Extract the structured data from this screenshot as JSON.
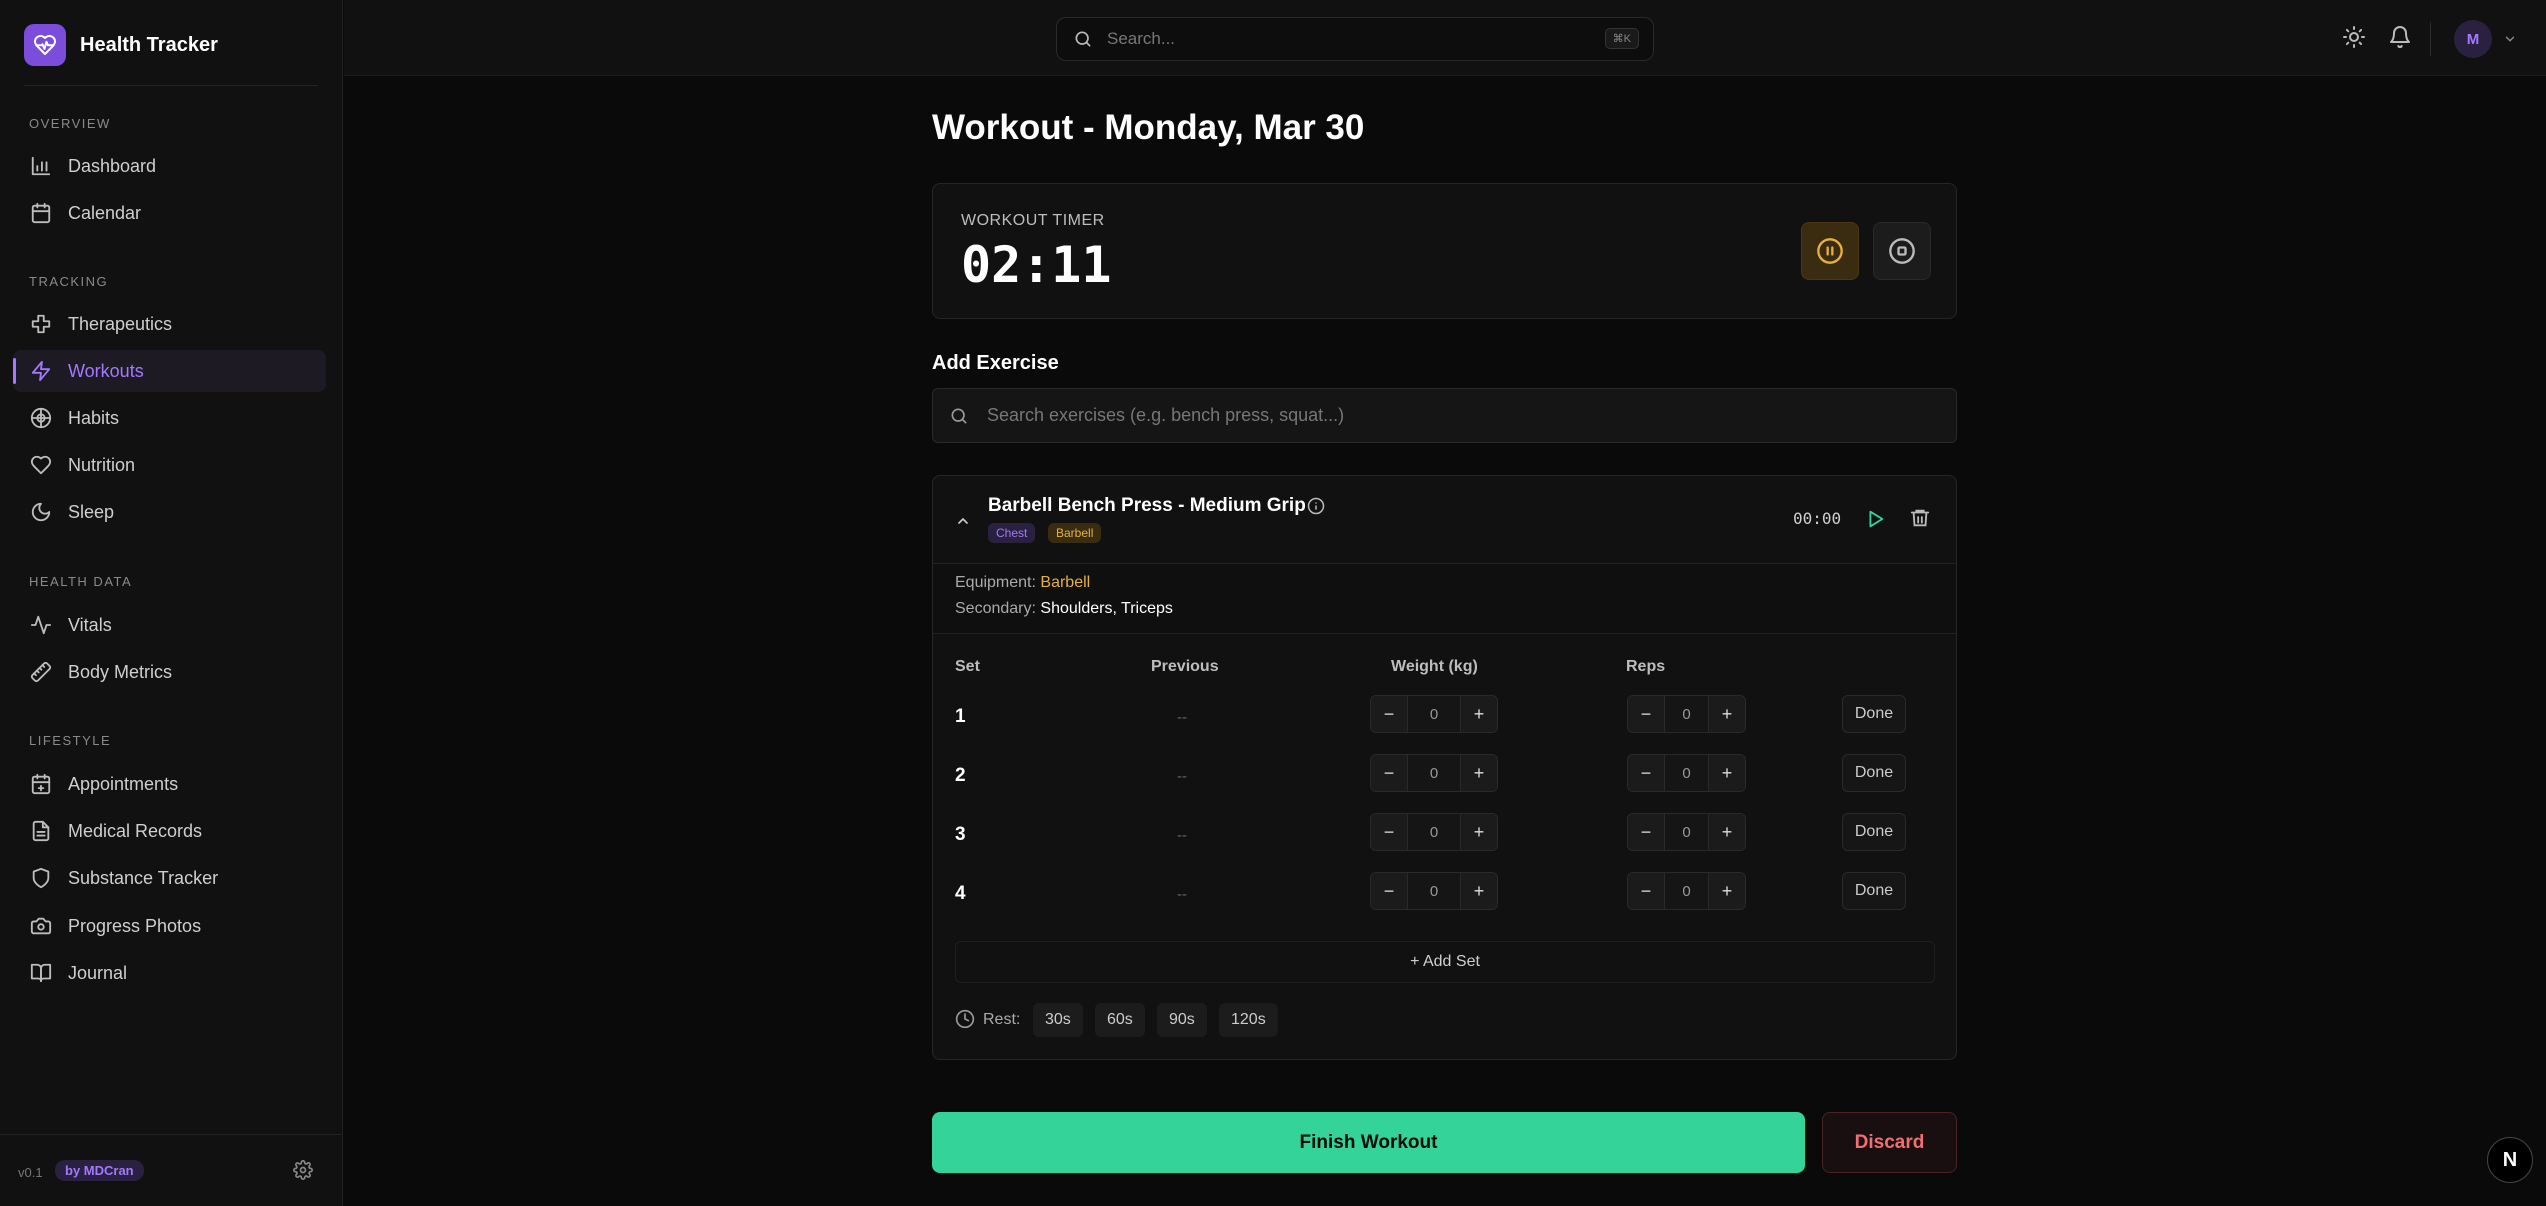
{
  "app": {
    "name": "Health Tracker",
    "version": "v0.1",
    "author_badge": "by MDCran"
  },
  "sidebar": {
    "sections": [
      {
        "label": "OVERVIEW",
        "items": [
          {
            "label": "Dashboard",
            "icon": "bar-chart-icon"
          },
          {
            "label": "Calendar",
            "icon": "calendar-icon"
          }
        ]
      },
      {
        "label": "TRACKING",
        "items": [
          {
            "label": "Therapeutics",
            "icon": "cross-icon"
          },
          {
            "label": "Workouts",
            "icon": "bolt-icon",
            "active": true
          },
          {
            "label": "Habits",
            "icon": "target-icon"
          },
          {
            "label": "Nutrition",
            "icon": "heart-icon"
          },
          {
            "label": "Sleep",
            "icon": "moon-icon"
          }
        ]
      },
      {
        "label": "HEALTH DATA",
        "items": [
          {
            "label": "Vitals",
            "icon": "pulse-icon"
          },
          {
            "label": "Body Metrics",
            "icon": "ruler-icon"
          }
        ]
      },
      {
        "label": "LIFESTYLE",
        "items": [
          {
            "label": "Appointments",
            "icon": "calendar-plus-icon"
          },
          {
            "label": "Medical Records",
            "icon": "file-icon"
          },
          {
            "label": "Substance Tracker",
            "icon": "shield-icon"
          },
          {
            "label": "Progress Photos",
            "icon": "camera-icon"
          },
          {
            "label": "Journal",
            "icon": "book-icon"
          }
        ]
      }
    ]
  },
  "topbar": {
    "search_placeholder": "Search...",
    "shortcut": "⌘K",
    "avatar_initial": "M"
  },
  "page": {
    "title": "Workout - Monday, Mar 30"
  },
  "timer": {
    "label": "WORKOUT TIMER",
    "value": "02:11"
  },
  "add_exercise": {
    "title": "Add Exercise",
    "placeholder": "Search exercises (e.g. bench press, squat...)"
  },
  "exercise": {
    "name": "Barbell Bench Press - Medium Grip",
    "tags": [
      "Chest",
      "Barbell"
    ],
    "elapsed": "00:00",
    "equipment_label": "Equipment:",
    "equipment": "Barbell",
    "secondary_label": "Secondary:",
    "secondary": "Shoulders, Triceps",
    "columns": [
      "Set",
      "Previous",
      "Weight (kg)",
      "Reps"
    ],
    "sets": [
      {
        "set": "1",
        "previous": "--",
        "weight": "0",
        "reps": "0",
        "done_label": "Done"
      },
      {
        "set": "2",
        "previous": "--",
        "weight": "0",
        "reps": "0",
        "done_label": "Done"
      },
      {
        "set": "3",
        "previous": "--",
        "weight": "0",
        "reps": "0",
        "done_label": "Done"
      },
      {
        "set": "4",
        "previous": "--",
        "weight": "0",
        "reps": "0",
        "done_label": "Done"
      }
    ],
    "add_set_label": "+ Add Set",
    "rest_label": "Rest:",
    "rest_options": [
      "30s",
      "60s",
      "90s",
      "120s"
    ]
  },
  "actions": {
    "finish_label": "Finish Workout",
    "discard_label": "Discard"
  },
  "fab_label": "N",
  "colors": {
    "accent": "#a478ff",
    "success": "#34d399",
    "gold": "#e6b040",
    "danger": "#f07070"
  }
}
